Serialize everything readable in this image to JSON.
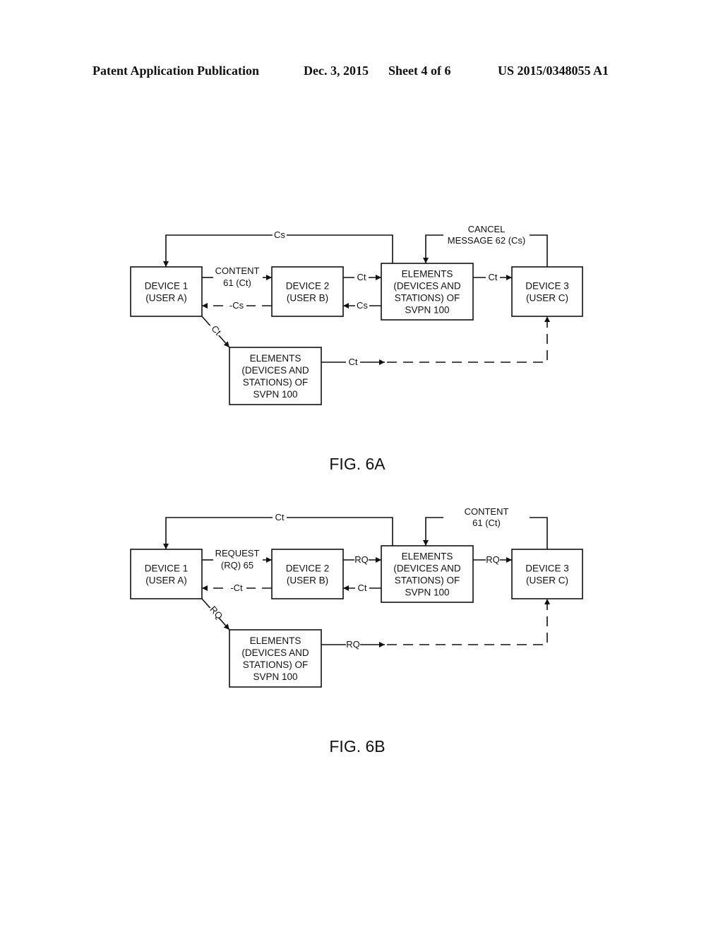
{
  "header": {
    "left": "Patent Application Publication",
    "date": "Dec. 3, 2015",
    "sheet": "Sheet 4 of 6",
    "number": "US 2015/0348055 A1"
  },
  "figures": [
    {
      "caption": "FIG. 6A",
      "device1": [
        "DEVICE 1",
        "(USER A)"
      ],
      "device2": [
        "DEVICE 2",
        "(USER B)"
      ],
      "device3": [
        "DEVICE 3",
        "(USER C)"
      ],
      "elements_mid": [
        "ELEMENTS",
        "(DEVICES AND",
        "STATIONS) OF",
        "SVPN 100"
      ],
      "elements_low": [
        "ELEMENTS",
        "(DEVICES AND",
        "STATIONS) OF",
        "SVPN 100"
      ],
      "top_return_label": "Cs",
      "loop_label": [
        "CANCEL",
        "MESSAGE 62 (Cs)"
      ],
      "d1_d2_label": [
        "CONTENT",
        "61 (Ct)"
      ],
      "d2_d1_label": "-Cs",
      "d2_em_label": "Ct",
      "em_d2_label": "Cs",
      "em_d3_label": "Ct",
      "d1_el_label": "Ct",
      "el_d3_label": "Ct"
    },
    {
      "caption": "FIG. 6B",
      "device1": [
        "DEVICE 1",
        "(USER A)"
      ],
      "device2": [
        "DEVICE 2",
        "(USER B)"
      ],
      "device3": [
        "DEVICE 3",
        "(USER C)"
      ],
      "elements_mid": [
        "ELEMENTS",
        "(DEVICES AND",
        "STATIONS) OF",
        "SVPN 100"
      ],
      "elements_low": [
        "ELEMENTS",
        "(DEVICES AND",
        "STATIONS) OF",
        "SVPN 100"
      ],
      "top_return_label": "Ct",
      "loop_label": [
        "CONTENT",
        "61 (Ct)"
      ],
      "d1_d2_label": [
        "REQUEST",
        "(RQ) 65"
      ],
      "d2_d1_label": "-Ct",
      "d2_em_label": "RQ",
      "em_d2_label": "Ct",
      "em_d3_label": "RQ",
      "d1_el_label": "RQ",
      "el_d3_label": "RQ"
    }
  ]
}
